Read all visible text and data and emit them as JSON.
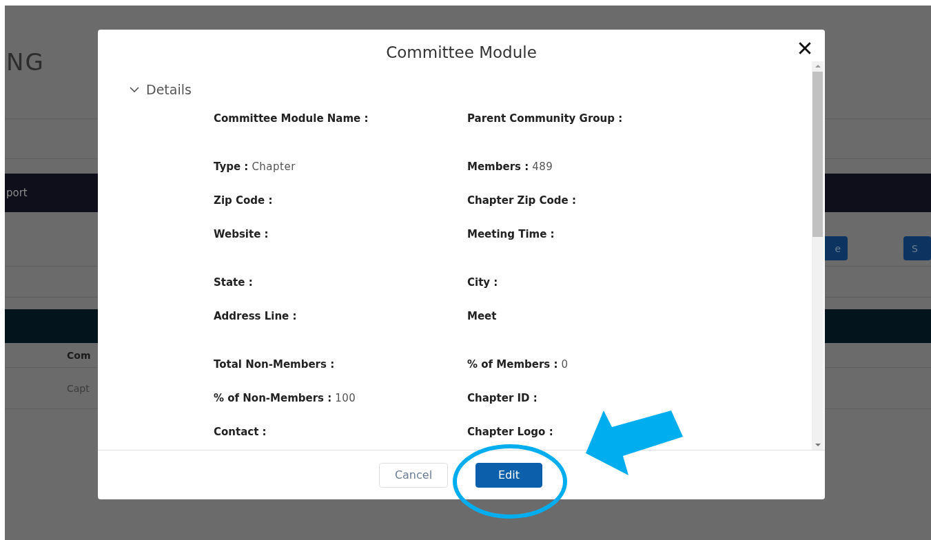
{
  "background_page": {
    "title": "NG",
    "nav_item": "port",
    "buttons": [
      "e",
      "S"
    ],
    "table": {
      "column_1": "Com",
      "row_1": "Capt"
    }
  },
  "modal": {
    "title": "Committee Module",
    "section": {
      "title": "Details",
      "expanded": true,
      "groups": [
        {
          "rows": [
            [
              {
                "label": "Committee Module Name :"
              },
              {
                "label": "Parent Community Group :"
              }
            ]
          ]
        },
        {
          "rows": [
            [
              {
                "label": "Type :",
                "value": "Chapter"
              },
              {
                "label": "Members :",
                "value": "489"
              }
            ],
            [
              {
                "label": "Zip Code :"
              },
              {
                "label": "Chapter Zip Code :"
              }
            ],
            [
              {
                "label": "Website :"
              },
              {
                "label": "Meeting Time :"
              }
            ]
          ]
        },
        {
          "rows": [
            [
              {
                "label": "State :"
              },
              {
                "label": "City :"
              }
            ],
            [
              {
                "label": "Address Line :"
              },
              {
                "label": "Meet"
              }
            ]
          ]
        },
        {
          "rows": [
            [
              {
                "label": "Total Non-Members :"
              },
              {
                "label": "% of Members :",
                "value": "0"
              }
            ],
            [
              {
                "label": "% of Non-Members :",
                "value": "100"
              },
              {
                "label": "Chapter ID :"
              }
            ],
            [
              {
                "label": "Contact :"
              },
              {
                "label": "Chapter Logo :"
              }
            ]
          ]
        }
      ]
    },
    "buttons": [
      {
        "label": "Cancel",
        "kind": "secondary"
      },
      {
        "label": "Edit",
        "kind": "primary"
      }
    ]
  }
}
